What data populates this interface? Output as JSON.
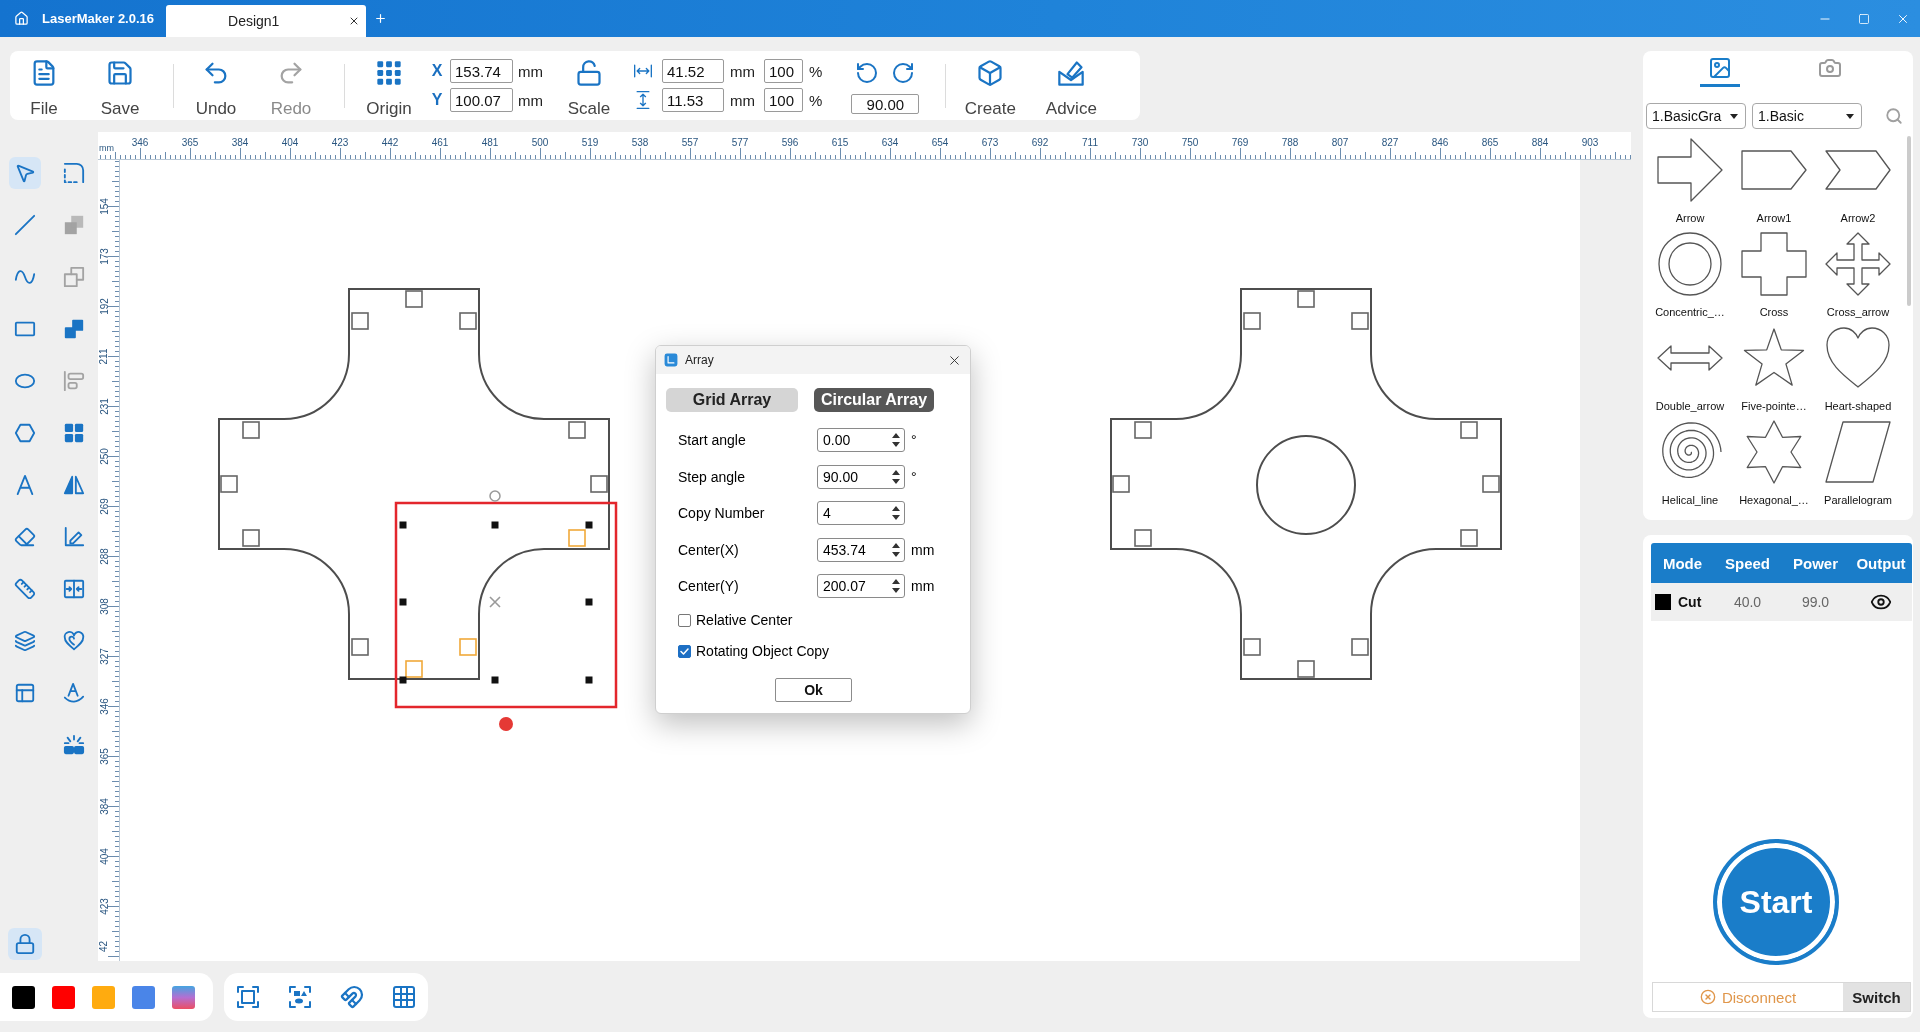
{
  "title_bar": {
    "app_name": "LaserMaker 2.0.16",
    "tabs": [
      {
        "label": "Design1",
        "selected": true
      }
    ]
  },
  "toolbar": {
    "file_buttons": [
      {
        "label": "File",
        "disabled": false
      },
      {
        "label": "Save",
        "disabled": false
      }
    ],
    "history_buttons": [
      {
        "label": "Undo",
        "disabled": false
      },
      {
        "label": "Redo",
        "disabled": true
      }
    ],
    "origin_button": {
      "label": "Origin"
    },
    "position": {
      "x_label": "X",
      "x_value": "153.74",
      "x_unit": "mm",
      "y_label": "Y",
      "y_value": "100.07",
      "y_unit": "mm"
    },
    "scale_button": {
      "label": "Scale"
    },
    "size": {
      "width_value": "41.52",
      "width_unit": "mm",
      "width_percent": "100",
      "width_percent_sign": "%",
      "height_value": "11.53",
      "height_unit": "mm",
      "height_percent": "100",
      "height_percent_sign": "%"
    },
    "rotation": {
      "angle": "90.00"
    },
    "extra_buttons": [
      {
        "label": "Create",
        "disabled": false
      },
      {
        "label": "Advice",
        "disabled": false
      }
    ]
  },
  "left_toolbox": {
    "columns": [
      {
        "tools": [
          {
            "selected": true,
            "disabled": false
          },
          {
            "selected": false,
            "disabled": false
          },
          {
            "selected": false,
            "disabled": false
          },
          {
            "selected": false,
            "disabled": false
          },
          {
            "selected": false,
            "disabled": false
          },
          {
            "selected": false,
            "disabled": false
          },
          {
            "selected": false,
            "disabled": false
          },
          {
            "selected": false,
            "disabled": false
          },
          {
            "selected": false,
            "disabled": false
          },
          {
            "selected": false,
            "disabled": false
          },
          {
            "selected": false,
            "disabled": false
          }
        ]
      },
      {
        "tools": [
          {
            "selected": false,
            "disabled": false
          },
          {
            "selected": false,
            "disabled": true
          },
          {
            "selected": false,
            "disabled": true
          },
          {
            "selected": false,
            "disabled": false
          },
          {
            "selected": false,
            "disabled": true
          },
          {
            "selected": false,
            "disabled": false
          },
          {
            "selected": false,
            "disabled": false
          },
          {
            "selected": false,
            "disabled": false
          },
          {
            "selected": false,
            "disabled": false
          },
          {
            "selected": false,
            "disabled": false
          },
          {
            "selected": false,
            "disabled": false
          },
          {
            "selected": false,
            "disabled": false
          }
        ]
      }
    ],
    "lock_button": {
      "on": true
    }
  },
  "rulers": {
    "top": {
      "unit": "mm",
      "labels": [
        "346",
        "365",
        "384",
        "404",
        "423",
        "442",
        "461",
        "481",
        "500",
        "519",
        "538",
        "557",
        "577",
        "596",
        "615",
        "634",
        "654",
        "673",
        "692",
        "711",
        "730",
        "750",
        "769",
        "788",
        "807",
        "827",
        "846",
        "865",
        "884",
        "903"
      ]
    },
    "left": {
      "labels": [
        "154",
        "173",
        "192",
        "211",
        "231",
        "250",
        "269",
        "288",
        "308",
        "327",
        "346",
        "365",
        "384",
        "404",
        "423",
        "42"
      ]
    }
  },
  "array_dialog": {
    "title": "Array",
    "tabs": [
      {
        "label": "Grid Array",
        "selected": false
      },
      {
        "label": "Circular Array",
        "selected": true
      }
    ],
    "fields": [
      {
        "label": "Start angle",
        "value": "0.00",
        "unit": "°"
      },
      {
        "label": "Step angle",
        "value": "90.00",
        "unit": "°"
      },
      {
        "label": "Copy Number",
        "value": "4"
      },
      {
        "label": "Center(X)",
        "value": "453.74",
        "unit": "mm"
      },
      {
        "label": "Center(Y)",
        "value": "200.07",
        "unit": "mm"
      }
    ],
    "checkboxes": [
      {
        "label": "Relative Center",
        "checked": false
      },
      {
        "label": "Rotating Object Copy",
        "checked": true
      }
    ],
    "ok_button": "Ok"
  },
  "shape_library": {
    "tabs": [
      {
        "selected": true
      },
      {
        "selected": false
      }
    ],
    "category": "1.BasicGra",
    "subcategory": "1.Basic",
    "shapes": [
      {
        "label": "Arrow"
      },
      {
        "label": "Arrow1"
      },
      {
        "label": "Arrow2"
      },
      {
        "label": "Concentric_…"
      },
      {
        "label": "Cross"
      },
      {
        "label": "Cross_arrow"
      },
      {
        "label": "Double_arrow"
      },
      {
        "label": "Five-pointe…"
      },
      {
        "label": "Heart-shaped"
      },
      {
        "label": "Helical_line"
      },
      {
        "label": "Hexagonal_…"
      },
      {
        "label": "Parallelogram"
      }
    ]
  },
  "layers_table": {
    "columns": [
      "Mode",
      "Speed",
      "Power",
      "Output"
    ],
    "rows": [
      {
        "color": "#000000",
        "mode": "Cut",
        "speed": "40.0",
        "power": "99.0",
        "visible": true
      }
    ]
  },
  "start_button": {
    "label": "Start"
  },
  "connection": {
    "status": "Disconnect",
    "switch_label": "Switch"
  },
  "color_palette": [
    {
      "kind": "solid",
      "color": "#000000"
    },
    {
      "kind": "solid",
      "color": "#ff0000"
    },
    {
      "kind": "solid",
      "color": "#ffab0f"
    },
    {
      "kind": "solid",
      "color": "#4a85e8"
    },
    {
      "kind": "gradient"
    }
  ]
}
